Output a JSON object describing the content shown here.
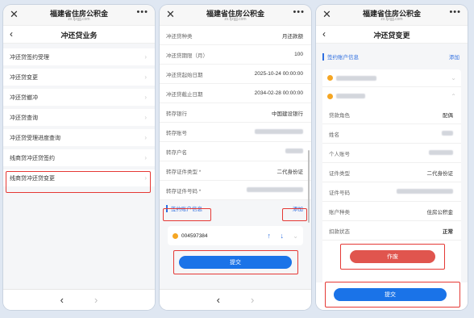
{
  "common": {
    "site_title": "福建省住房公积金",
    "site_sub": "zx.fjzgjj.com",
    "close_glyph": "✕",
    "more_glyph": "•••",
    "back_glyph": "‹",
    "nav_prev": "‹",
    "nav_next": "›"
  },
  "p1": {
    "nav_title": "冲还贷业务",
    "items": [
      {
        "label": "冲还贷签约受理"
      },
      {
        "label": "冲还贷变更"
      },
      {
        "label": "冲还贷撤冲"
      },
      {
        "label": "冲还贷查询"
      },
      {
        "label": "冲还贷受理进度查询"
      },
      {
        "label": "线商贷冲还贷签约"
      },
      {
        "label": "线商贷冲还贷变更"
      }
    ]
  },
  "p2": {
    "fields": [
      {
        "label": "冲还贷种类",
        "value": "月还款额"
      },
      {
        "label": "冲还贷期限（月）",
        "value": "100"
      },
      {
        "label": "冲还贷起始日期",
        "value": "2025-10-24 00:00:00"
      },
      {
        "label": "冲还贷截止日期",
        "value": "2034-02-28 00:00:00"
      },
      {
        "label": "转存银行",
        "value": "中国建设银行"
      },
      {
        "label": "转存账号",
        "value": ""
      },
      {
        "label": "转存户名",
        "value": ""
      },
      {
        "label": "转存证件类型 *",
        "value": "二代身份证"
      },
      {
        "label": "转存证件号码 *",
        "value": ""
      }
    ],
    "section_title": "签约账户信息",
    "add_label": "添加",
    "account_no": "004597384",
    "up_glyph": "↑",
    "down_glyph": "↓",
    "submit_label": "提交"
  },
  "p3": {
    "nav_title": "冲还贷变更",
    "section_title": "签约账户信息",
    "add_label": "添加",
    "rows": [
      {
        "label": "贷款角色",
        "value": "配偶"
      },
      {
        "label": "姓名",
        "value": ""
      },
      {
        "label": "个人账号",
        "value": ""
      },
      {
        "label": "证件类型",
        "value": "二代身份证"
      },
      {
        "label": "证件号码",
        "value": ""
      },
      {
        "label": "账户种类",
        "value": "住房公积金"
      },
      {
        "label": "扣款状态",
        "value": "正常"
      }
    ],
    "void_label": "作废",
    "submit_label": "提交"
  }
}
